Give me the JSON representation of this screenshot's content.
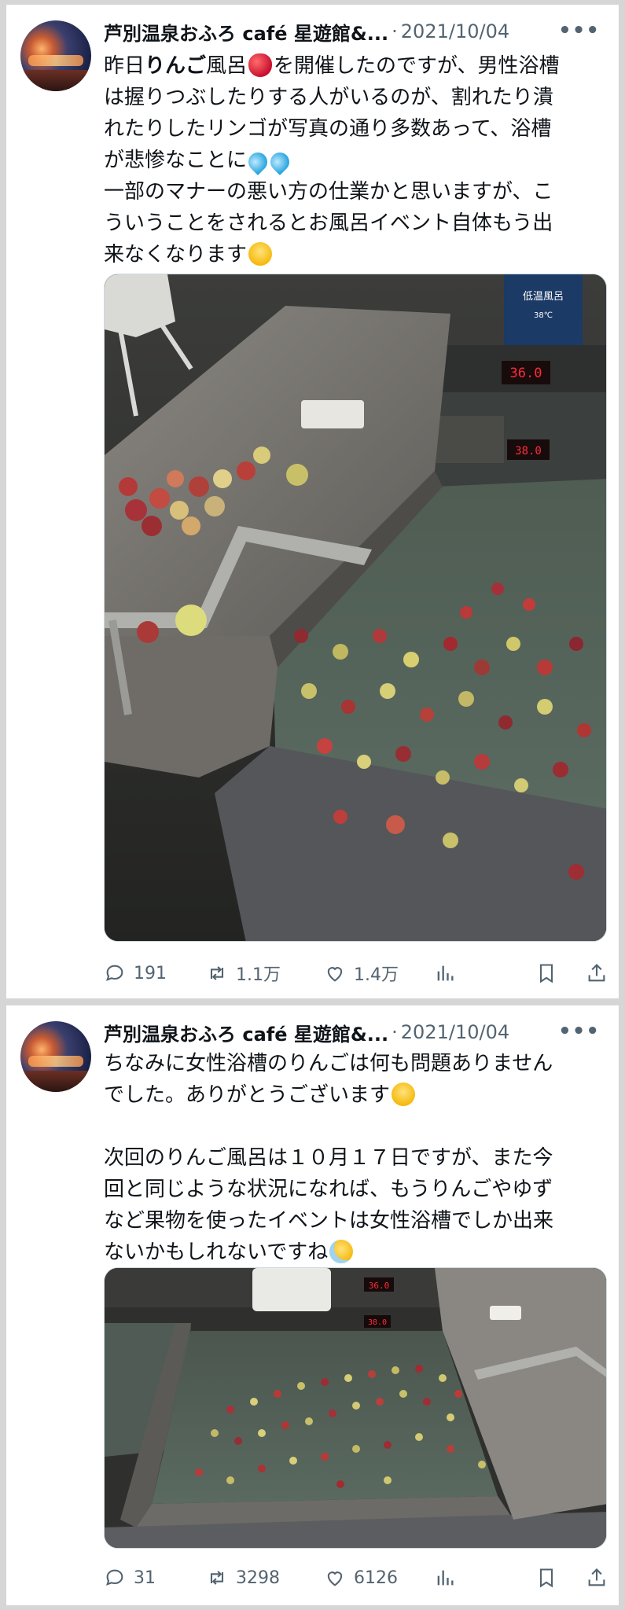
{
  "posts": [
    {
      "author": "芦別温泉おふろ café 星遊館&...",
      "separator": "·",
      "date": "2021/10/04",
      "more": "•••",
      "text_lines": {
        "l1a": "昨日",
        "l1b": "りんご",
        "l1c": "風呂",
        "l1d": "を開催したのですが、男性浴槽",
        "l2": "は握りつぶしたりする人がいるのが、割れたり潰",
        "l3": "れたりしたリンゴが写真の通り多数あって、浴槽",
        "l4": "が悲惨なことに",
        "l5": "一部のマナーの悪い方の仕業かと思いますが、こ",
        "l6": "ういうことをされるとお風呂イベント自体もう出",
        "l7": "来なくなります"
      },
      "photo": {
        "sign_title": "低温風呂",
        "sign_temp": "38℃",
        "display_red1": "36.0",
        "display_red2": "38.0"
      },
      "stats": {
        "replies": "191",
        "reposts": "1.1万",
        "likes": "1.4万"
      },
      "icons": [
        "reply-icon",
        "repost-icon",
        "like-icon",
        "views-icon",
        "bookmark-icon",
        "share-icon"
      ]
    },
    {
      "author": "芦別温泉おふろ café 星遊館&...",
      "separator": "·",
      "date": "2021/10/04",
      "more": "•••",
      "text_lines": {
        "l1": "ちなみに女性浴槽のりんごは何も問題ありません",
        "l2": "でした。ありがとうございます",
        "l3": "次回のりんご風呂は１０月１７日ですが、また今",
        "l4": "回と同じような状況になれば、もうりんごやゆず",
        "l5": "など果物を使ったイベントは女性浴槽でしか出来",
        "l6": "ないかもしれないですね"
      },
      "photo": {
        "display_red1": "36.0",
        "display_red2": "38.0"
      },
      "stats": {
        "replies": "31",
        "reposts": "3298",
        "likes": "6126"
      },
      "icons": [
        "reply-icon",
        "repost-icon",
        "like-icon",
        "views-icon",
        "bookmark-icon",
        "share-icon"
      ]
    }
  ]
}
